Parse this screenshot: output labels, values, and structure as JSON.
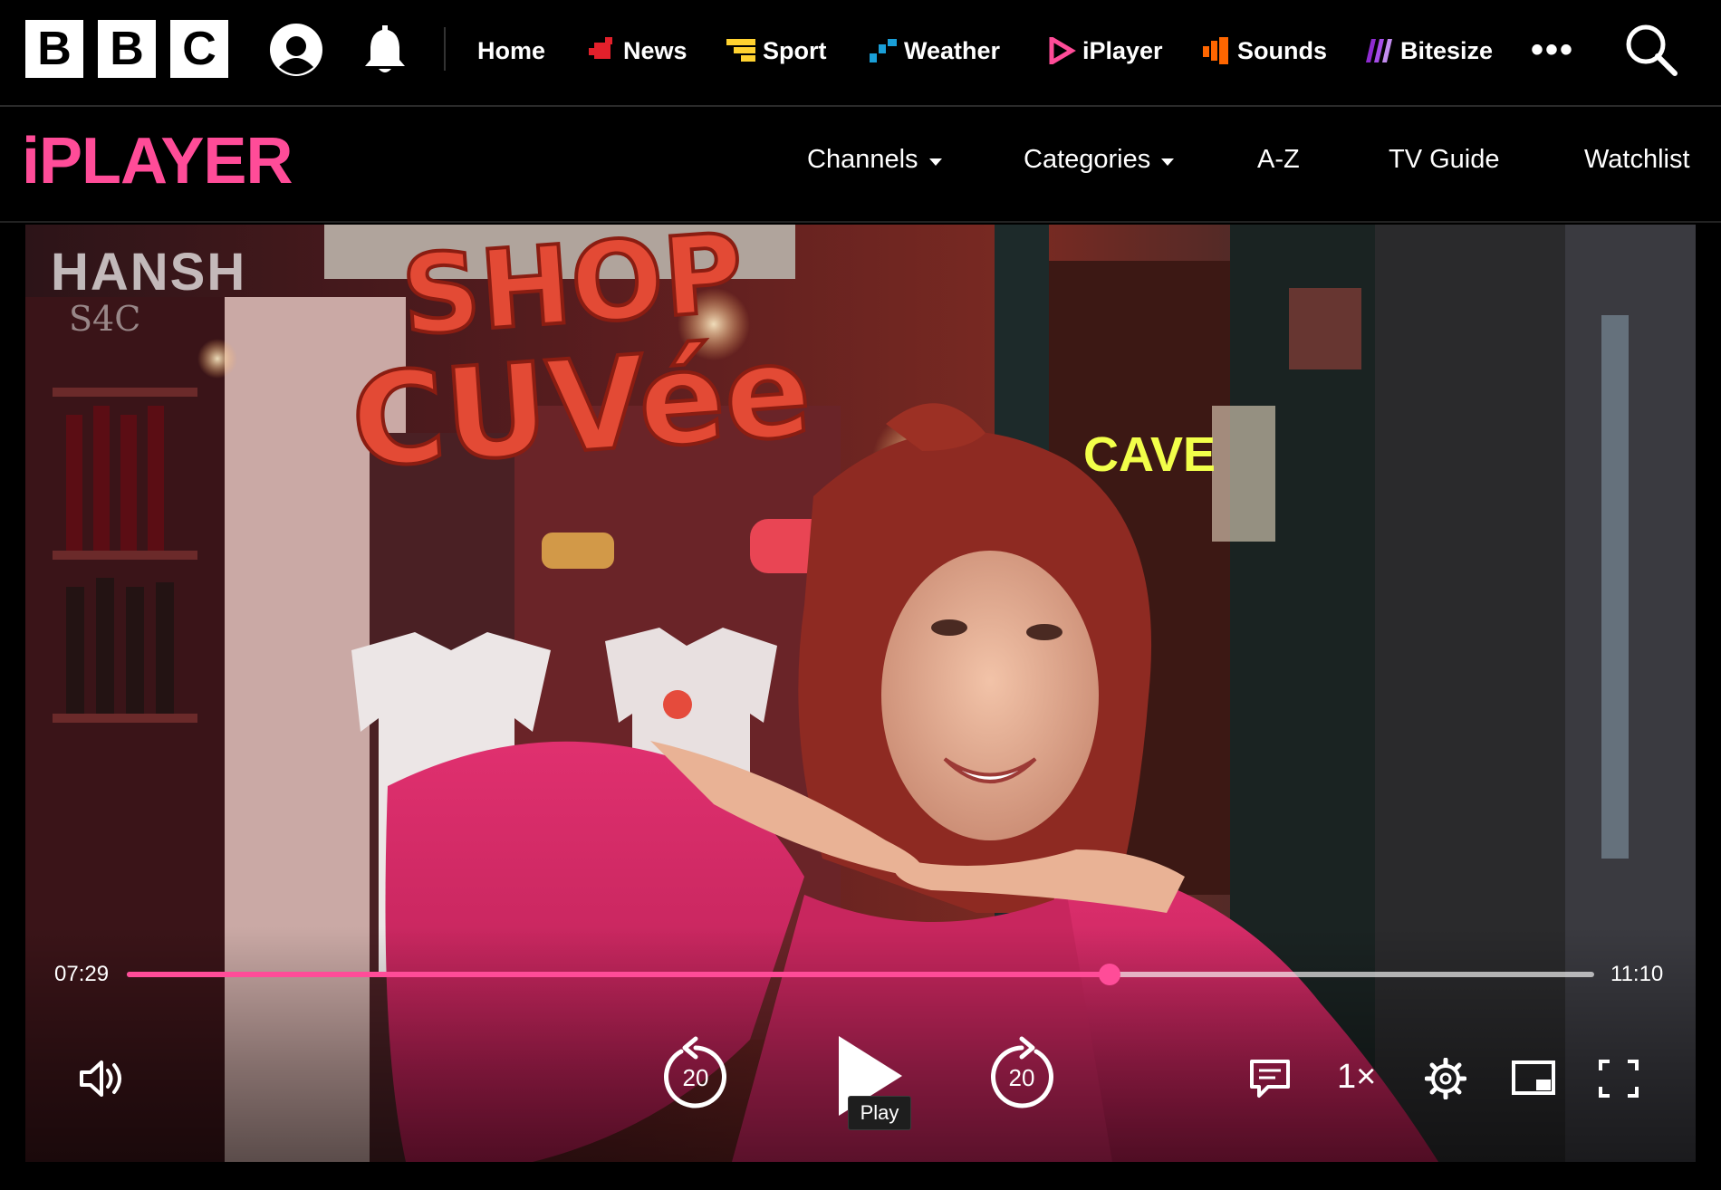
{
  "global_nav": {
    "logo_letters": [
      "B",
      "B",
      "C"
    ],
    "account_icon": "account-icon",
    "notifications_icon": "bell-icon",
    "items": [
      {
        "label": "Home",
        "icon": "",
        "accent": ""
      },
      {
        "label": "News",
        "icon": "news-mark-icon",
        "accent": "#e3202b"
      },
      {
        "label": "Sport",
        "icon": "sport-mark-icon",
        "accent": "#ffd230"
      },
      {
        "label": "Weather",
        "icon": "weather-mark-icon",
        "accent": "#1a9fd8"
      },
      {
        "label": "iPlayer",
        "icon": "iplayer-mark-icon",
        "accent": "#ff4c98"
      },
      {
        "label": "Sounds",
        "icon": "sounds-mark-icon",
        "accent": "#ff6600"
      },
      {
        "label": "Bitesize",
        "icon": "bitesize-mark-icon",
        "accent": "#8f2bd1"
      }
    ],
    "more_label": "•••",
    "search_icon": "search-icon"
  },
  "iplayer_nav": {
    "logo": "iPLAYER",
    "logo_color": "#ff4c98",
    "items": [
      {
        "label": "Channels",
        "has_dropdown": true
      },
      {
        "label": "Categories",
        "has_dropdown": true
      },
      {
        "label": "A-Z",
        "has_dropdown": false
      },
      {
        "label": "TV Guide",
        "has_dropdown": false
      },
      {
        "label": "Watchlist",
        "has_dropdown": false
      }
    ]
  },
  "video": {
    "channel_watermark": "HANSH",
    "channel_sub": "S4C",
    "sign_top": "SHOP",
    "sign_bottom": "CUVée",
    "neon_sign": "CAVE"
  },
  "player_controls": {
    "current_time": "07:29",
    "duration": "11:10",
    "progress": 0.67,
    "progress_color": "#ff4c98",
    "volume_icon": "volume-icon",
    "rewind_seconds": "20",
    "play_icon": "play-icon",
    "play_tooltip": "Play",
    "forward_seconds": "20",
    "subtitles_icon": "subtitles-icon",
    "speed_label": "1×",
    "settings_icon": "gear-icon",
    "pip_icon": "picture-in-picture-icon",
    "fullscreen_icon": "fullscreen-icon"
  }
}
